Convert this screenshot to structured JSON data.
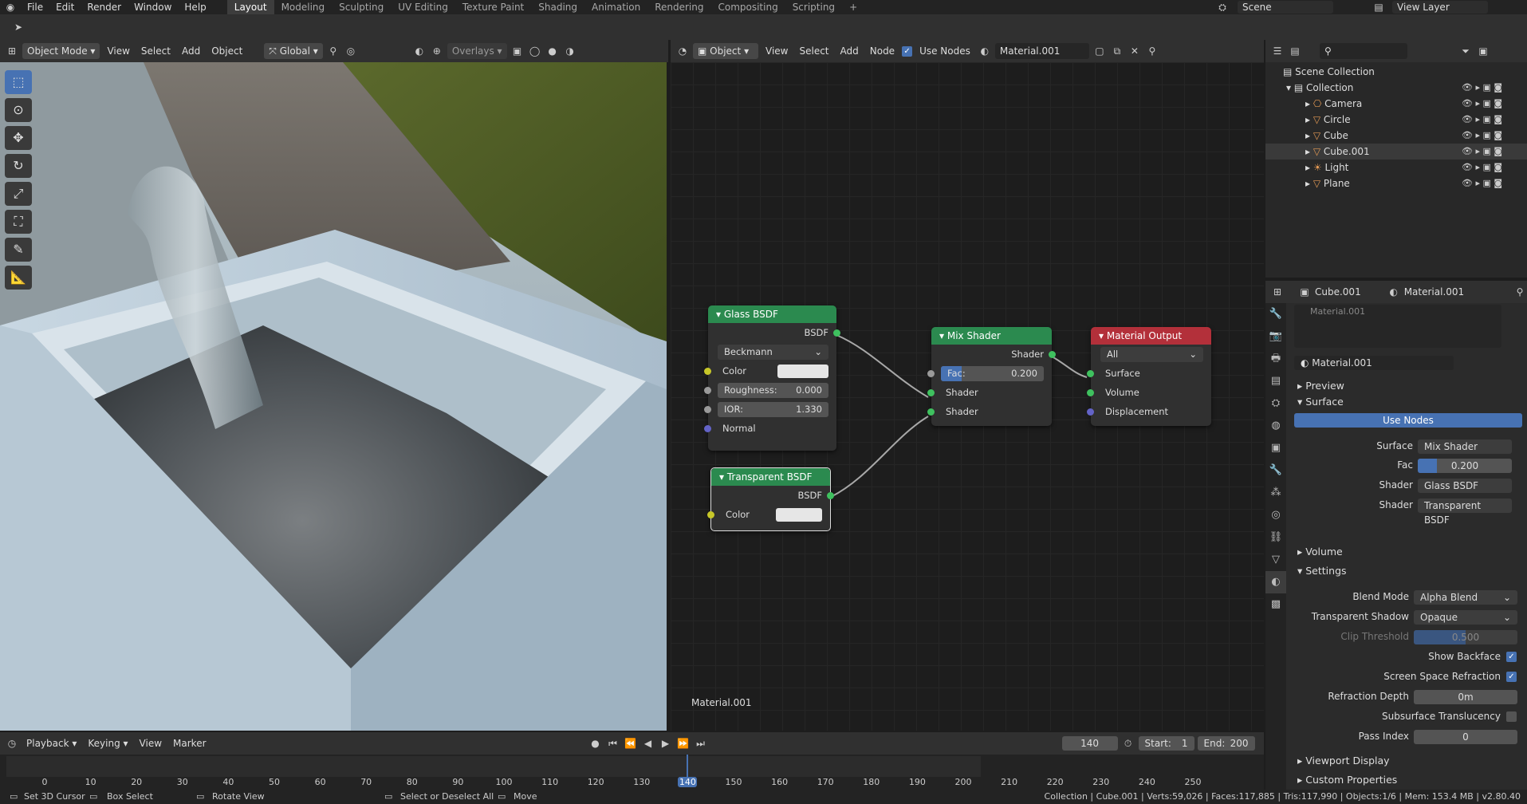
{
  "menu": [
    "File",
    "Edit",
    "Render",
    "Window",
    "Help"
  ],
  "workspaces": [
    "Layout",
    "Modeling",
    "Sculpting",
    "UV Editing",
    "Texture Paint",
    "Shading",
    "Animation",
    "Rendering",
    "Compositing",
    "Scripting"
  ],
  "active_workspace": "Layout",
  "scene": "Scene",
  "view_layer": "View Layer",
  "viewport": {
    "mode": "Object Mode",
    "menus": [
      "View",
      "Select",
      "Add",
      "Object"
    ],
    "orientation": "Global",
    "overlays": "Overlays"
  },
  "node_editor": {
    "object_label": "Object",
    "menus": [
      "View",
      "Select",
      "Add",
      "Node"
    ],
    "use_nodes_label": "Use Nodes",
    "material": "Material.001",
    "footer": "Material.001"
  },
  "nodes": {
    "glass": {
      "title": "Glass BSDF",
      "output": "BSDF",
      "distribution": "Beckmann",
      "color": "Color",
      "roughness_label": "Roughness:",
      "roughness": "0.000",
      "ior_label": "IOR:",
      "ior": "1.330",
      "normal": "Normal"
    },
    "transparent": {
      "title": "Transparent BSDF",
      "output": "BSDF",
      "color": "Color"
    },
    "mix": {
      "title": "Mix Shader",
      "output": "Shader",
      "fac_label": "Fac:",
      "fac": "0.200",
      "fac_fraction": 0.2,
      "shader1": "Shader",
      "shader2": "Shader"
    },
    "output": {
      "title": "Material Output",
      "target": "All",
      "surface": "Surface",
      "volume": "Volume",
      "displacement": "Displacement"
    }
  },
  "outliner": {
    "root": "Scene Collection",
    "collection": "Collection",
    "items": [
      {
        "name": "Camera",
        "icon": "camera-icon"
      },
      {
        "name": "Circle",
        "icon": "mesh-icon"
      },
      {
        "name": "Cube",
        "icon": "mesh-icon"
      },
      {
        "name": "Cube.001",
        "icon": "mesh-icon",
        "selected": true
      },
      {
        "name": "Light",
        "icon": "light-icon"
      },
      {
        "name": "Plane",
        "icon": "mesh-icon"
      }
    ]
  },
  "properties": {
    "object": "Cube.001",
    "material": "Material.001",
    "slot": "Material.001",
    "sections": {
      "preview": "Preview",
      "surface": "Surface",
      "volume": "Volume",
      "settings": "Settings",
      "viewport_display": "Viewport Display",
      "custom_properties": "Custom Properties"
    },
    "use_nodes": "Use Nodes",
    "surface_label": "Surface",
    "surface_value": "Mix Shader",
    "fac_label": "Fac",
    "fac_value": "0.200",
    "fac_fraction": 0.2,
    "shader_label": "Shader",
    "shader1_value": "Glass BSDF",
    "shader2_value": "Transparent BSDF",
    "blend_mode_label": "Blend Mode",
    "blend_mode": "Alpha Blend",
    "transparent_shadow_label": "Transparent Shadow",
    "transparent_shadow": "Opaque",
    "clip_threshold_label": "Clip Threshold",
    "clip_threshold": "0.500",
    "clip_fraction": 0.5,
    "show_backface": "Show Backface",
    "ssr": "Screen Space Refraction",
    "refraction_depth_label": "Refraction Depth",
    "refraction_depth": "0m",
    "subsurface": "Subsurface Translucency",
    "pass_index_label": "Pass Index",
    "pass_index": "0"
  },
  "timeline": {
    "menus": [
      "Playback",
      "Keying",
      "View",
      "Marker"
    ],
    "current_frame": "140",
    "start_label": "Start:",
    "start": "1",
    "end_label": "End:",
    "end": "200",
    "ticks": [
      "0",
      "10",
      "20",
      "30",
      "40",
      "50",
      "60",
      "70",
      "80",
      "90",
      "100",
      "110",
      "120",
      "130",
      "140",
      "150",
      "160",
      "170",
      "180",
      "190",
      "200",
      "210",
      "220",
      "230",
      "240",
      "250"
    ]
  },
  "status": {
    "left": [
      "Set 3D Cursor",
      "Box Select",
      "Rotate View",
      "Select or Deselect All",
      "Move"
    ],
    "right": "Collection | Cube.001 | Verts:59,026 | Faces:117,885 | Tris:117,990 | Objects:1/6 | Mem: 153.4 MB | v2.80.40"
  },
  "colors": {
    "accent": "#4772b3",
    "node_green": "#2b8a4f",
    "node_red": "#b3303a"
  }
}
